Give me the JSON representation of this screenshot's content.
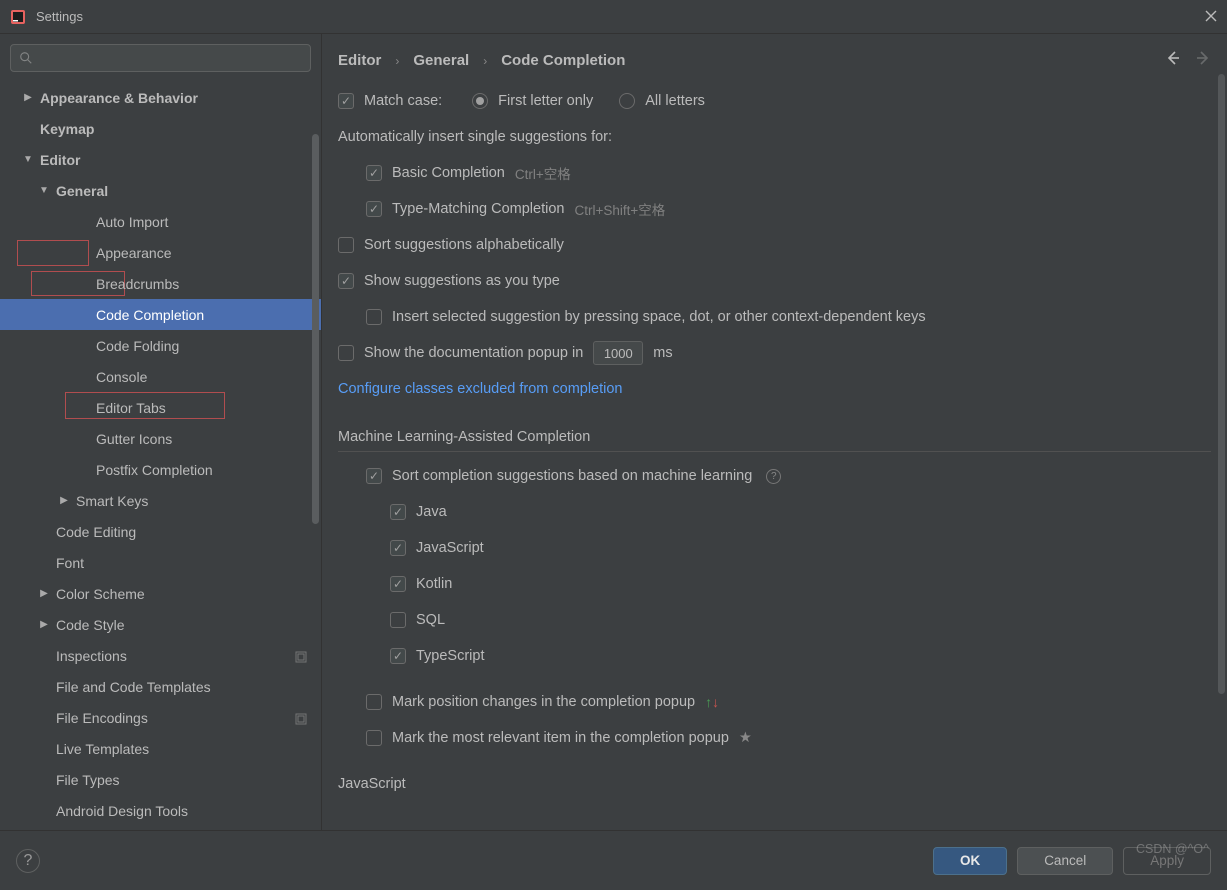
{
  "window": {
    "title": "Settings"
  },
  "sidebar": {
    "items": [
      {
        "label": "Appearance & Behavior",
        "depth": 0,
        "chev": "right",
        "bold": true
      },
      {
        "label": "Keymap",
        "depth": 0,
        "chev": "",
        "bold": true
      },
      {
        "label": "Editor",
        "depth": 0,
        "chev": "down",
        "bold": true
      },
      {
        "label": "General",
        "depth": 1,
        "chev": "down",
        "bold": true
      },
      {
        "label": "Auto Import",
        "depth": 3,
        "chev": ""
      },
      {
        "label": "Appearance",
        "depth": 3,
        "chev": ""
      },
      {
        "label": "Breadcrumbs",
        "depth": 3,
        "chev": ""
      },
      {
        "label": "Code Completion",
        "depth": 3,
        "chev": "",
        "selected": true
      },
      {
        "label": "Code Folding",
        "depth": 3,
        "chev": ""
      },
      {
        "label": "Console",
        "depth": 3,
        "chev": ""
      },
      {
        "label": "Editor Tabs",
        "depth": 3,
        "chev": ""
      },
      {
        "label": "Gutter Icons",
        "depth": 3,
        "chev": ""
      },
      {
        "label": "Postfix Completion",
        "depth": 3,
        "chev": ""
      },
      {
        "label": "Smart Keys",
        "depth": 2,
        "chev": "right"
      },
      {
        "label": "Code Editing",
        "depth": 1,
        "chev": ""
      },
      {
        "label": "Font",
        "depth": 1,
        "chev": ""
      },
      {
        "label": "Color Scheme",
        "depth": 1,
        "chev": "right"
      },
      {
        "label": "Code Style",
        "depth": 1,
        "chev": "right"
      },
      {
        "label": "Inspections",
        "depth": 1,
        "chev": "",
        "proj": true
      },
      {
        "label": "File and Code Templates",
        "depth": 1,
        "chev": ""
      },
      {
        "label": "File Encodings",
        "depth": 1,
        "chev": "",
        "proj": true
      },
      {
        "label": "Live Templates",
        "depth": 1,
        "chev": ""
      },
      {
        "label": "File Types",
        "depth": 1,
        "chev": ""
      },
      {
        "label": "Android Design Tools",
        "depth": 1,
        "chev": ""
      }
    ]
  },
  "breadcrumbs": {
    "a": "Editor",
    "b": "General",
    "c": "Code Completion"
  },
  "opts": {
    "match_case": "Match case:",
    "first_letter": "First letter only",
    "all_letters": "All letters",
    "auto_insert_header": "Automatically insert single suggestions for:",
    "basic": "Basic Completion",
    "basic_sc": "Ctrl+空格",
    "typematch": "Type-Matching Completion",
    "typematch_sc": "Ctrl+Shift+空格",
    "sort_alpha": "Sort suggestions alphabetically",
    "show_as_type": "Show suggestions as you type",
    "insert_space": "Insert selected suggestion by pressing space, dot, or other context-dependent keys",
    "show_doc": "Show the documentation popup in",
    "doc_ms": "1000",
    "ms": "ms",
    "configure_link": "Configure classes excluded from completion",
    "ml_header": "Machine Learning-Assisted Completion",
    "ml_sort": "Sort completion suggestions based on machine learning",
    "java": "Java",
    "js": "JavaScript",
    "kotlin": "Kotlin",
    "sql": "SQL",
    "ts": "TypeScript",
    "mark_pos": "Mark position changes in the completion popup",
    "mark_rel": "Mark the most relevant item in the completion popup",
    "js_header": "JavaScript"
  },
  "footer": {
    "ok": "OK",
    "cancel": "Cancel",
    "apply": "Apply"
  },
  "watermark": "CSDN @^O^"
}
